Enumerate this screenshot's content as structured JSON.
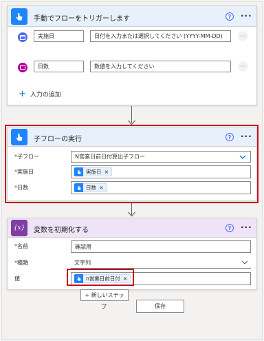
{
  "trigger": {
    "title": "手動でフローをトリガーします",
    "help": "?",
    "more": "···",
    "rows": [
      {
        "label": "実施日",
        "placeholder": "日付を入力または選択してください (YYYY-MM-DD)",
        "more": "···"
      },
      {
        "label": "日数",
        "placeholder": "数値を入力してください",
        "more": "···"
      }
    ],
    "add_input": "入力の追加",
    "add_icon": "+"
  },
  "child_flow": {
    "title": "子フローの実行",
    "help": "?",
    "more": "···",
    "fields": {
      "child_label": "子フロー",
      "child_value": "N営業日前日付算出子フロー",
      "date_label": "実施日",
      "date_token": "実施日",
      "days_label": "日数",
      "days_token": "日数"
    },
    "required_mark": "*"
  },
  "init_var": {
    "title": "変数を初期化する",
    "icon_text": "{x}",
    "help": "?",
    "more": "···",
    "fields": {
      "name_label": "名前",
      "name_value": "確認用",
      "type_label": "種類",
      "type_value": "文字列",
      "value_label": "値",
      "value_token": "n営業日前日付"
    },
    "required_mark": "*"
  },
  "footer": {
    "new_step_line1": "+ 新しいステッ",
    "new_step_line2": "プ",
    "save": "保存"
  },
  "token_remove": "×",
  "colors": {
    "trigger_header": "#e8f1fb",
    "blue": "#1f85ff",
    "purple": "#7e3ea3",
    "var_header": "#efe4f7",
    "highlight": "#c50f1f",
    "date_icon": "#4f6bed",
    "number_icon": "#b4009e"
  }
}
